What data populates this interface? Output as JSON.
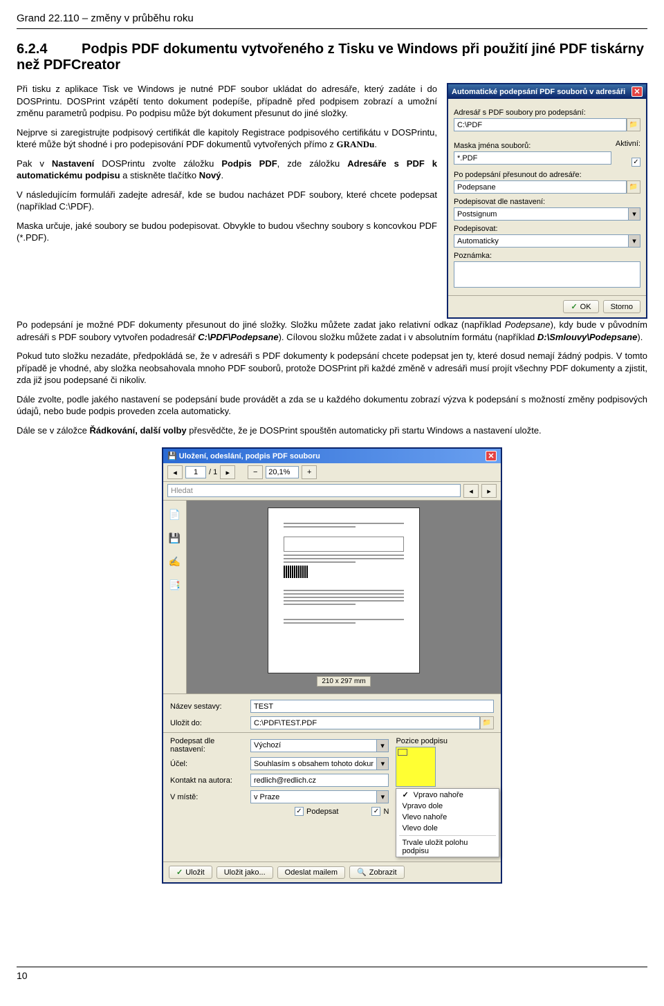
{
  "header": "Grand 22.110 – změny v průběhu roku",
  "section_number": "6.2.4",
  "section_title": "Podpis PDF dokumentu vytvořeného z Tisku ve Windows při použití jiné PDF tiskárny než PDFCreator",
  "paragraphs": {
    "p1a": "Při tisku z aplikace Tisk ve Windows je nutné PDF soubor ukládat do adresáře, který zadáte i do DOSPrintu. DOSPrint vzápětí tento dokument podepíše, případně před podpisem zobrazí a umožní změnu parametrů podpisu. Po podpisu může být dokument přesunut do jiné složky.",
    "p2a": "Nejprve si zaregistrujte podpisový certifikát dle kapitoly Registrace podpisového certifikátu v DOSPrintu, které může být shodné i pro podepisování PDF dokumentů vytvořených přímo z ",
    "p2b": ".",
    "p3a": "Pak v ",
    "p3b": " DOSPrintu zvolte záložku ",
    "p3c": ", zde záložku ",
    "p3d": " a stiskněte tlačítko ",
    "p3e": ".",
    "p4": "V následujícím formuláři zadejte adresář, kde se budou nacházet PDF soubory, které chcete podepsat (například C:\\PDF).",
    "p5": "Maska určuje, jaké soubory se budou podepisovat. Obvykle to budou všechny soubory s koncovkou PDF (*.PDF).",
    "p6a": "Po podepsání je možné PDF dokumenty přesunout do jiné složky. Složku můžete zadat jako relativní odkaz (například ",
    "p6b": "), kdy bude v původním adresáři s PDF soubory vytvořen podadresář ",
    "p6c": "). Cílovou složku můžete zadat i v absolutním formátu (například ",
    "p6d": ").",
    "p7": "Pokud tuto složku nezadáte, předpokládá se, že v adresáři s PDF dokumenty k podepsání chcete podepsat jen ty, které dosud nemají žádný podpis. V tomto případě je vhodné, aby složka neobsahovala mnoho PDF souborů, protože DOSPrint při každé změně v adresáři musí projít všechny PDF dokumenty a zjistit, zda již jsou podepsané či nikoliv.",
    "p8": "Dále zvolte, podle jakého nastavení se podepsání bude provádět a zda se u každého dokumentu zobrazí výzva k podepsání s možností změny podpisových údajů, nebo bude podpis proveden zcela automaticky.",
    "p9a": "Dále se v záložce ",
    "p9b": " přesvědčte, že je DOSPrint spouštěn automaticky při startu Windows a nastavení uložte."
  },
  "bold_inline": {
    "nastaveni": "Nastavení",
    "podpis_pdf": "Podpis PDF",
    "adresare": "Adresáře s PDF k automatickému podpisu",
    "novy": "Nový",
    "radkovani": "Řádkování, další volby"
  },
  "ital_inline": {
    "grandu": "GRANDu",
    "podepsane": "Podepsane",
    "cpdf": "C:\\PDF\\Podepsane",
    "dsml": "D:\\Smlouvy\\Podepsane"
  },
  "dialog1": {
    "title": "Automatické podepsání PDF souborů v adresáři",
    "lbl_adresar": "Adresář s PDF soubory pro podepsání:",
    "val_adresar": "C:\\PDF",
    "lbl_maska": "Maska jména souborů:",
    "val_maska": "*.PDF",
    "lbl_aktivni": "Aktivní:",
    "lbl_presunout": "Po podepsání přesunout do adresáře:",
    "val_presunout": "Podepsane",
    "lbl_dle": "Podepisovat dle nastavení:",
    "val_dle": "Postsignum",
    "lbl_podepisovat": "Podepisovat:",
    "val_podepisovat": "Automaticky",
    "lbl_poznamka": "Poznámka:",
    "btn_ok": "OK",
    "btn_storno": "Storno"
  },
  "dialog2": {
    "title": "Uložení, odeslání, podpis PDF souboru",
    "page_cur": "1",
    "page_sep": "/ 1",
    "zoom": "20,1%",
    "search_ph": "Hledat",
    "page_size": "210 x 297 mm",
    "lbl_nazev": "Název sestavy:",
    "val_nazev": "TEST",
    "lbl_ulozit_do": "Uložit do:",
    "val_ulozit_do": "C:\\PDF\\TEST.PDF",
    "lbl_podepsat_dle": "Podepsat dle nastavení:",
    "val_podepsat_dle": "Výchozí",
    "lbl_ucel": "Účel:",
    "val_ucel": "Souhlasím s obsahem tohoto dokumentu",
    "lbl_kontakt": "Kontakt na autora:",
    "val_kontakt": "redlich@redlich.cz",
    "lbl_vmiste": "V místě:",
    "val_vmiste": "v Praze",
    "chk_podepsat": "Podepsat",
    "chk_n": "N",
    "lbl_pozice": "Pozice podpisu",
    "menu": {
      "m1": "Vpravo nahoře",
      "m2": "Vpravo dole",
      "m3": "Vlevo nahoře",
      "m4": "Vlevo dole",
      "m5": "Trvale uložit polohu podpisu"
    },
    "btn_ulozit": "Uložit",
    "btn_ulozit_jako": "Uložit jako...",
    "btn_odeslat": "Odeslat mailem",
    "btn_zobrazit": "Zobrazit"
  },
  "page_number": "10"
}
